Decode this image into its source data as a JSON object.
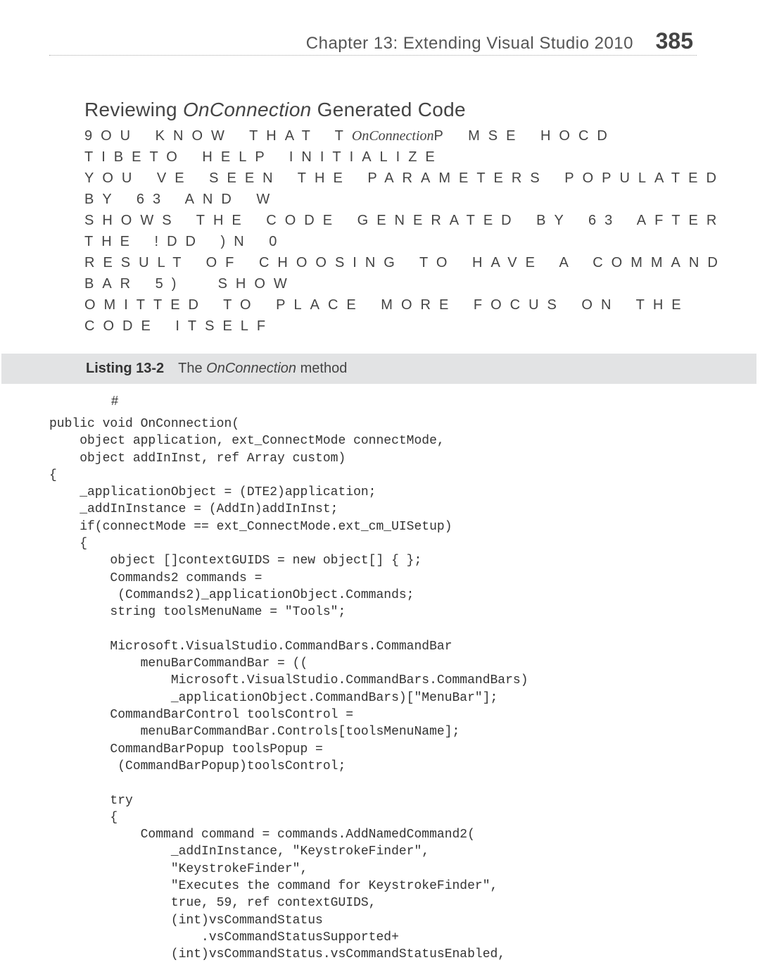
{
  "header": {
    "chapter": "Chapter 13:   Extending Visual Studio 2010",
    "page": "385"
  },
  "section": {
    "heading_prefix": "Reviewing ",
    "heading_italic": "OnConnection",
    "heading_suffix": " Generated Code",
    "para_line1a": "9OU KNOW THAT T",
    "para_line1_italic": "OnConnection",
    "para_line1b": "P MSE HOCD TIBETO HELP INITIALIZE",
    "para_line2": "YOU VE SEEN THE PARAMETERS POPULATED BY 63 AND W",
    "para_line3": "SHOWS THE CODE GENERATED BY 63 AFTER THE !DD )N 0",
    "para_line4": "RESULT OF CHOOSING TO HAVE A COMMAND BAR 5)  SHOW",
    "para_line5": "OMITTED TO PLACE MORE FOCUS ON THE CODE ITSELF"
  },
  "listing": {
    "label": "Listing 13-2",
    "title_prefix": "The ",
    "title_italic": "OnConnection",
    "title_suffix": " method"
  },
  "code": {
    "lang": "#",
    "body": "public void OnConnection(\n    object application, ext_ConnectMode connectMode,\n    object addInInst, ref Array custom)\n{\n    _applicationObject = (DTE2)application;\n    _addInInstance = (AddIn)addInInst;\n    if(connectMode == ext_ConnectMode.ext_cm_UISetup)\n    {\n        object []contextGUIDS = new object[] { };\n        Commands2 commands =\n         (Commands2)_applicationObject.Commands;\n        string toolsMenuName = \"Tools\";\n\n        Microsoft.VisualStudio.CommandBars.CommandBar\n            menuBarCommandBar = ((\n                Microsoft.VisualStudio.CommandBars.CommandBars)\n                _applicationObject.CommandBars)[\"MenuBar\"];\n        CommandBarControl toolsControl =\n            menuBarCommandBar.Controls[toolsMenuName];\n        CommandBarPopup toolsPopup =\n         (CommandBarPopup)toolsControl;\n\n        try\n        {\n            Command command = commands.AddNamedCommand2(\n                _addInInstance, \"KeystrokeFinder\",\n                \"KeystrokeFinder\",\n                \"Executes the command for KeystrokeFinder\",\n                true, 59, ref contextGUIDS,\n                (int)vsCommandStatus\n                    .vsCommandStatusSupported+\n                (int)vsCommandStatus.vsCommandStatusEnabled,"
  }
}
